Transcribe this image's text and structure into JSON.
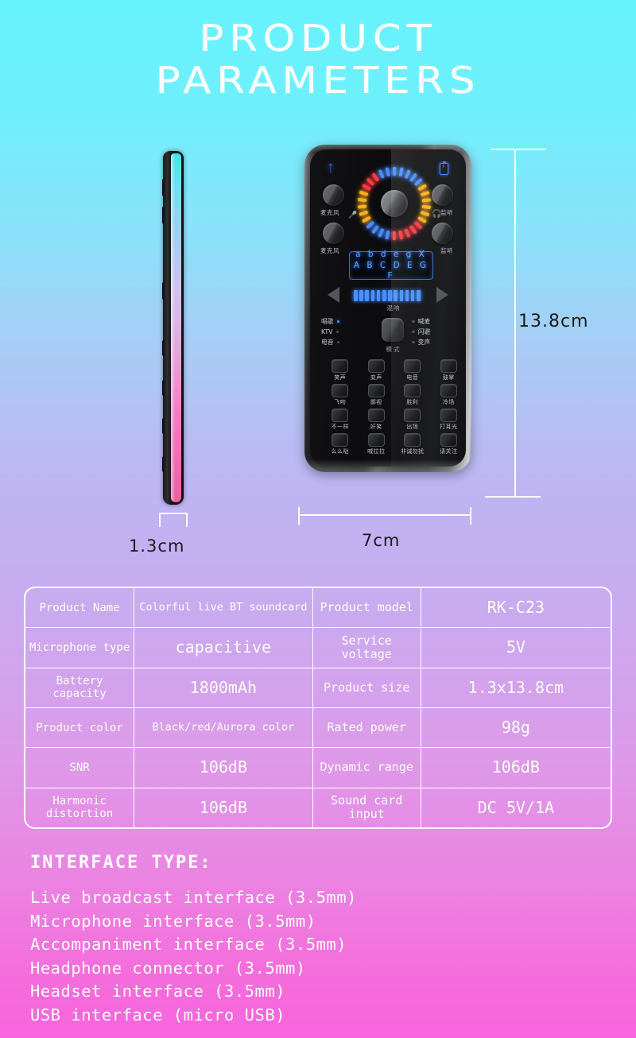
{
  "title": {
    "line1": "PRODUCT",
    "line2": "PARAMETERS"
  },
  "dimensions": {
    "thickness": "1.3cm",
    "width": "7cm",
    "height": "13.8cm"
  },
  "device": {
    "bluetooth_icon": "bluetooth-icon",
    "battery_icon": "battery-icon",
    "mic_glyph": "microphone-icon",
    "headphone_glyph": "headphone-icon",
    "knob_labels": {
      "mic_top": "麦克风",
      "mic_bottom": "麦克风",
      "monitor_top": "监听",
      "monitor_bottom": "监听"
    },
    "display": {
      "row1": "a b d e g X",
      "row2": "A B C D E G F"
    },
    "reverb_label": "混响",
    "mode_label": "模式",
    "modes_left": [
      {
        "label": "唱歌",
        "active": true
      },
      {
        "label": "KTV",
        "active": false
      },
      {
        "label": "电音",
        "active": false
      }
    ],
    "modes_right": [
      {
        "label": "喊麦",
        "active": false
      },
      {
        "label": "闪避",
        "active": false
      },
      {
        "label": "变声",
        "active": false
      }
    ],
    "pads": [
      "笑声",
      "变声",
      "电音",
      "鼓掌",
      "飞吻",
      "鄙视",
      "胜利",
      "冷场",
      "不一样",
      "奸笑",
      "出场",
      "打耳光",
      "么么哒",
      "喊拉拉",
      "非诚勿扰",
      "请关注"
    ],
    "led_colors": [
      "#4a8cff",
      "#ffb020",
      "#ff3b44"
    ]
  },
  "spec_table": {
    "rows": [
      {
        "label1": "Product Name",
        "value1": "Colorful live BT soundcard",
        "label2": "Product model",
        "value2": "RK-C23"
      },
      {
        "label1": "Microphone type",
        "value1": "capacitive",
        "label2": "Service voltage",
        "value2": "5V"
      },
      {
        "label1": "Battery capacity",
        "value1": "1800mAh",
        "label2": "Product size",
        "value2": "1.3x13.8cm"
      },
      {
        "label1": "Product color",
        "value1": "Black/red/Aurora color",
        "label2": "Rated power",
        "value2": "98g"
      },
      {
        "label1": "SNR",
        "value1": "106dB",
        "label2": "Dynamic range",
        "value2": "106dB"
      },
      {
        "label1": "Harmonic distortion",
        "value1": "106dB",
        "label2": "Sound card input",
        "value2": "DC 5V/1A"
      }
    ]
  },
  "interface": {
    "title": "INTERFACE TYPE:",
    "lines": [
      "Live broadcast interface (3.5mm)",
      "Microphone interface (3.5mm)",
      "Accompaniment interface (3.5mm)",
      "Headphone connector (3.5mm)",
      "Headset interface (3.5mm)",
      "USB interface (micro USB)"
    ]
  },
  "colors": {
    "bg_top": "#66f3fd",
    "bg_bottom": "#f765dc",
    "line": "#ffffff",
    "dim_text": "#1a1a1a"
  }
}
